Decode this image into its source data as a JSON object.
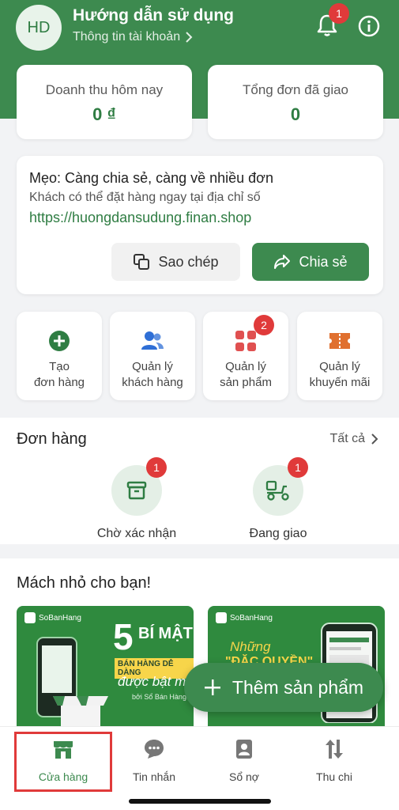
{
  "header": {
    "avatar_initials": "HD",
    "user_name": "Hướng dẫn sử dụng",
    "account_link": "Thông tin tài khoản",
    "notification_count": "1",
    "brand_color": "#3d8a4f"
  },
  "stats": {
    "revenue_label": "Doanh thu hôm nay",
    "revenue_value": "0 ₫",
    "delivered_label": "Tổng đơn đã giao",
    "delivered_value": "0"
  },
  "tip": {
    "title": "Mẹo: Càng chia sẻ, càng về nhiều đơn",
    "description": "Khách có thể đặt hàng ngay tại địa chỉ số",
    "link": "https://huongdansudung.finan.shop",
    "copy_label": "Sao chép",
    "share_label": "Chia sẻ"
  },
  "actions": [
    {
      "line1": "Tạo",
      "line2": "đơn hàng",
      "icon": "plus-circle-icon"
    },
    {
      "line1": "Quản lý",
      "line2": "khách hàng",
      "icon": "users-icon"
    },
    {
      "line1": "Quản lý",
      "line2": "sản phẩm",
      "icon": "grid-icon",
      "badge": "2"
    },
    {
      "line1": "Quản lý",
      "line2": "khuyến mãi",
      "icon": "voucher-icon"
    }
  ],
  "orders": {
    "title": "Đơn hàng",
    "see_all": "Tất cả",
    "items": [
      {
        "label": "Chờ xác nhận",
        "badge": "1",
        "icon": "archive-box-icon"
      },
      {
        "label": "Đang giao",
        "badge": "1",
        "icon": "delivery-scooter-icon"
      }
    ]
  },
  "tips_section": {
    "title": "Mách nhỏ cho bạn!",
    "banner_brand": "SoBanHang",
    "banner1": {
      "big": "5",
      "line1": "BÍ MẬT",
      "line2": "BÁN HÀNG DỄ DÀNG",
      "line3": "được bật mí",
      "line4": "bởi Sổ Bán Hàng"
    },
    "banner2": {
      "line1": "Những",
      "line2": "\"ĐẶC QUYỀN\""
    }
  },
  "fab": {
    "label": "Thêm sản phẩm"
  },
  "tabbar": [
    {
      "label": "Cửa hàng",
      "icon": "store-icon",
      "active": true
    },
    {
      "label": "Tin nhắn",
      "icon": "chat-bubble-icon"
    },
    {
      "label": "Sổ nợ",
      "icon": "ledger-contact-icon"
    },
    {
      "label": "Thu chi",
      "icon": "up-down-arrows-icon"
    }
  ]
}
